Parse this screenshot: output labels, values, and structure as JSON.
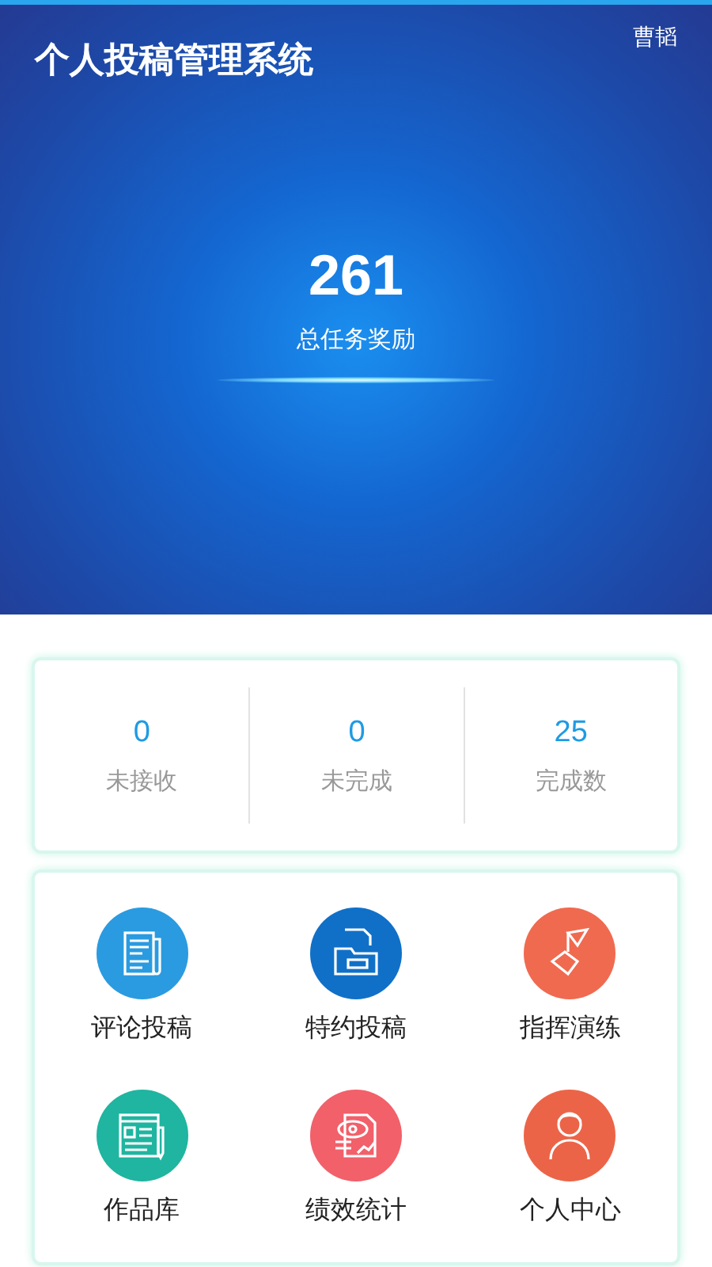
{
  "header": {
    "title": "个人投稿管理系统",
    "user": "曹韬",
    "total": "261",
    "total_label": "总任务奖励"
  },
  "stats": [
    {
      "value": "0",
      "label": "未接收"
    },
    {
      "value": "0",
      "label": "未完成"
    },
    {
      "value": "25",
      "label": "完成数"
    }
  ],
  "menu": [
    {
      "label": "评论投稿",
      "kind": "newspaper",
      "color": "#2a9be0"
    },
    {
      "label": "特约投稿",
      "kind": "folder",
      "color": "#1070c8"
    },
    {
      "label": "指挥演练",
      "kind": "flag",
      "color": "#f06a50"
    },
    {
      "label": "作品库",
      "kind": "editor",
      "color": "#1fb5a0"
    },
    {
      "label": "绩效统计",
      "kind": "report",
      "color": "#f2606a"
    },
    {
      "label": "个人中心",
      "kind": "person",
      "color": "#ec6448"
    }
  ]
}
